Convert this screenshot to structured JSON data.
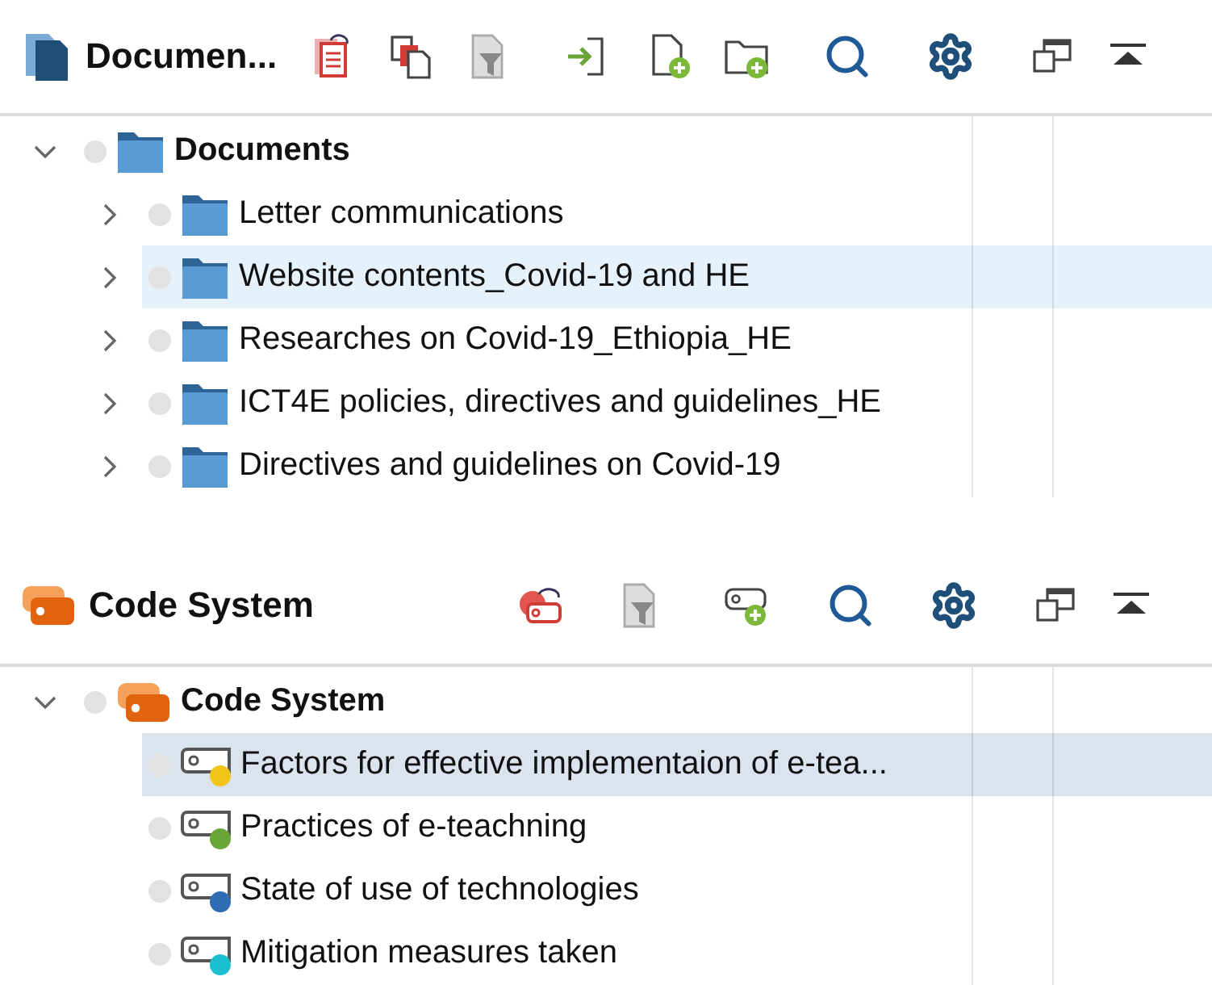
{
  "panels": [
    {
      "kind": "documents",
      "title": "Documen...",
      "tree": {
        "label": "Documents",
        "expanded": true,
        "selected": false,
        "children": [
          {
            "label": "Letter communications",
            "expanded": false,
            "selected": false
          },
          {
            "label": "Website contents_Covid-19 and HE",
            "expanded": false,
            "selected": true
          },
          {
            "label": "Researches on Covid-19_Ethiopia_HE",
            "expanded": false,
            "selected": false
          },
          {
            "label": "ICT4E policies, directives and guidelines_HE",
            "expanded": false,
            "selected": false
          },
          {
            "label": "Directives and guidelines on Covid-19",
            "expanded": false,
            "selected": false
          }
        ]
      }
    },
    {
      "kind": "codes",
      "title": "Code System",
      "tree": {
        "label": "Code System",
        "expanded": true,
        "selected": false,
        "children": [
          {
            "label": "Factors for effective implementaion of e-tea...",
            "selected": true,
            "color": "#f0c419"
          },
          {
            "label": "Practices of e-teachning",
            "selected": false,
            "color": "#6aa53a"
          },
          {
            "label": "State of use of technologies",
            "selected": false,
            "color": "#2e6db4"
          },
          {
            "label": "Mitigation measures taken",
            "selected": false,
            "color": "#1bbfcf"
          }
        ]
      }
    }
  ]
}
